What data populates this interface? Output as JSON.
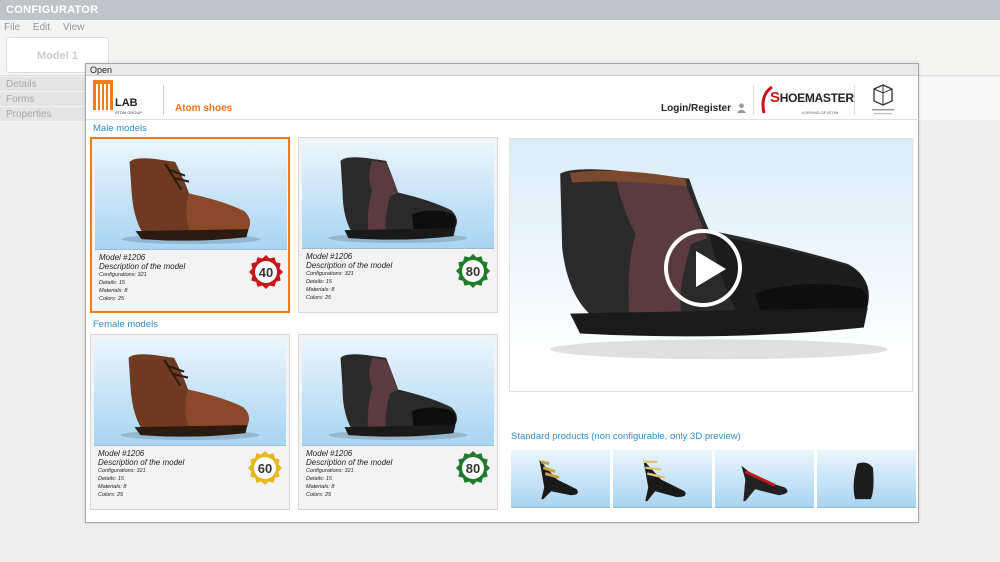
{
  "app": {
    "title": "CONFIGURATOR",
    "menu": [
      "File",
      "Edit",
      "View"
    ],
    "model_tab": "Model 1",
    "side": [
      "Details",
      "Forms",
      "Properties"
    ]
  },
  "dialog": {
    "title": "Open",
    "logo_text": "LAB",
    "logo_sub": "ATOM GROUP",
    "brand": "Atom shoes",
    "login": "Login/Register",
    "shoemaster_pre": "S",
    "shoemaster_text": "HOEMASTER",
    "shoemaster_sub": "A BRAND OF ATOM"
  },
  "sections": {
    "male": "Male models",
    "female": "Female models",
    "standard": "Standard products (non configurable, only 3D preview)"
  },
  "colors": {
    "accent": "#f07d1a",
    "link": "#2e8dc9",
    "badge_red": "#c9141c",
    "badge_green": "#1f7a2c",
    "badge_yellow": "#e4b81a"
  },
  "male_models": [
    {
      "model": "Model #1206",
      "desc": "Description of the model",
      "configs": "Configurations: 321",
      "details": "Details: 15",
      "materials": "Materials: 8",
      "colors": "Colors: 25",
      "score": "40",
      "badge": "red",
      "shoe": "brown"
    },
    {
      "model": "Model #1206",
      "desc": "Description of the model",
      "configs": "Configurations: 321",
      "details": "Details: 15",
      "materials": "Materials: 8",
      "colors": "Colors: 25",
      "score": "80",
      "badge": "green",
      "shoe": "black"
    }
  ],
  "female_models": [
    {
      "model": "Model #1206",
      "desc": "Description of the model",
      "configs": "Configurations: 321",
      "details": "Details: 15",
      "materials": "Materials: 8",
      "colors": "Colors: 25",
      "score": "60",
      "badge": "yellow",
      "shoe": "brown"
    },
    {
      "model": "Model #1206",
      "desc": "Description of the model",
      "configs": "Configurations: 321",
      "details": "Details: 15",
      "materials": "Materials: 8",
      "colors": "Colors: 25",
      "score": "80",
      "badge": "green",
      "shoe": "black"
    }
  ]
}
